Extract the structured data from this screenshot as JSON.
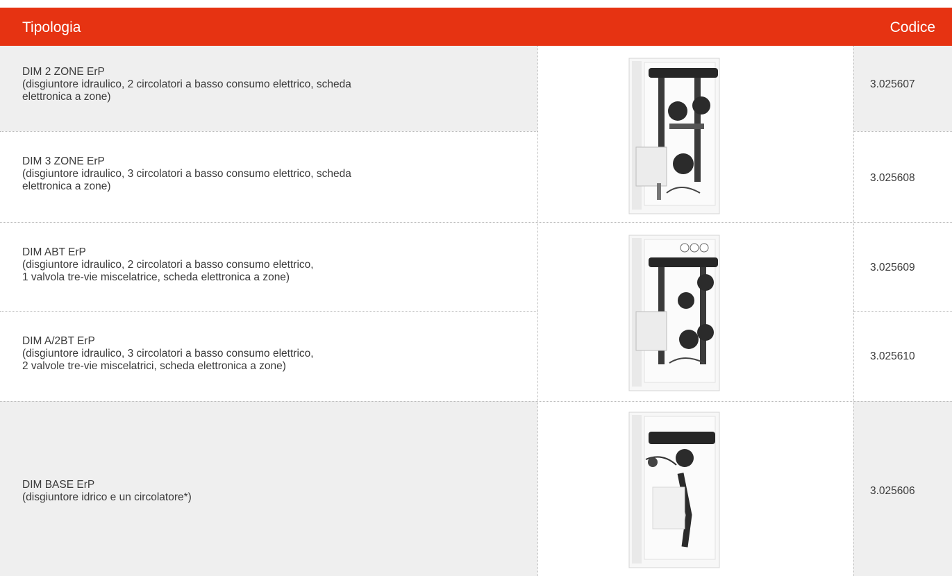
{
  "table": {
    "header": {
      "type_label": "Tipologia",
      "code_label": "Codice"
    },
    "rows": [
      {
        "name": "DIM 2 ZONE ErP",
        "desc_lines": [
          "(disgiuntore idraulico, 2 circolatori a basso consumo elettrico, scheda",
          "elettronica a zone)"
        ],
        "code": "3.025607"
      },
      {
        "name": "DIM 3 ZONE ErP",
        "desc_lines": [
          "(disgiuntore idraulico, 3 circolatori a basso consumo elettrico, scheda",
          "elettronica a zone)"
        ],
        "code": "3.025608"
      },
      {
        "name": "DIM ABT ErP",
        "desc_lines": [
          "(disgiuntore idraulico, 2 circolatori a basso consumo elettrico,",
          "1 valvola tre-vie miscelatrice, scheda elettronica a zone)"
        ],
        "code": "3.025609"
      },
      {
        "name": "DIM A/2BT ErP",
        "desc_lines": [
          "(disgiuntore idraulico, 3 circolatori a basso consumo elettrico,",
          "2 valvole tre-vie miscelatrici, scheda elettronica a zone)"
        ],
        "code": "3.025610"
      },
      {
        "name": "DIM BASE ErP",
        "desc_lines": [
          "(disgiuntore idrico e un circolatore*)"
        ],
        "code": "3.025606"
      }
    ]
  },
  "colors": {
    "header": "#e63312",
    "row_shade": "#efefef"
  },
  "images": [
    {
      "icon": "hydraulic-module-2-pumps-icon"
    },
    {
      "icon": "hydraulic-module-mixing-valve-icon"
    },
    {
      "icon": "hydraulic-module-single-pump-icon"
    }
  ]
}
